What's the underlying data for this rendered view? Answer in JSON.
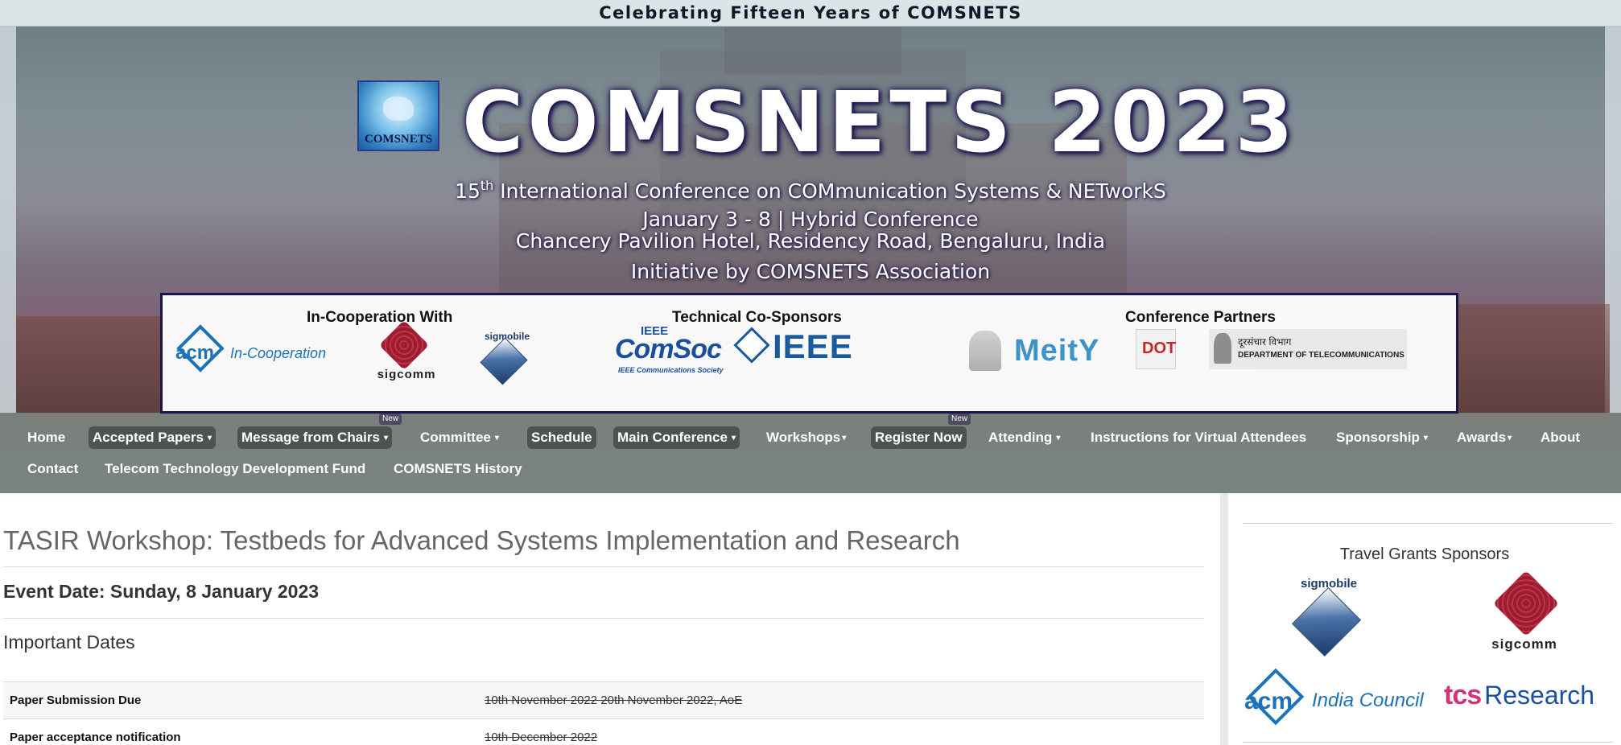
{
  "top_strip": {
    "text": "Celebrating Fifteen Years of COMSNETS"
  },
  "banner": {
    "logo_text": "COMSNETS",
    "title": "COMSNETS 2023",
    "subtitle_num": "15",
    "subtitle_sup": "th",
    "subtitle_rest": " International Conference on COMmunication Systems & NETworkS",
    "dates": "January 3 - 8 | Hybrid Conference",
    "venue": "Chancery Pavilion Hotel, Residency Road, Bengaluru, India",
    "initiative": "Initiative by COMSNETS Association"
  },
  "sponsors": {
    "coop_heading": "In-Cooperation With",
    "tech_heading": "Technical Co-Sponsors",
    "partners_heading": "Conference Partners",
    "acm_mark": "acm",
    "acm_coop": "In-Cooperation",
    "sigcomm": "sigcomm",
    "sigmobile": "sigmobile",
    "comsoc_l1": "IEEE",
    "comsoc_l2": "ComSoc",
    "comsoc_l3": "IEEE Communications Society",
    "ieee": "IEEE",
    "meity": "MeitY",
    "dot": "DOT",
    "dept_hindi": "दूरसंचार विभाग",
    "dept_en": "DEPARTMENT OF TELECOMMUNICATIONS"
  },
  "nav": {
    "home": "Home",
    "accepted_papers": "Accepted Papers",
    "message_from_chairs": "Message from Chairs",
    "committee": "Committee",
    "schedule": "Schedule",
    "main_conference": "Main Conference",
    "workshops": "Workshops",
    "register_now": "Register Now",
    "attending": "Attending",
    "virtual_instructions": "Instructions for Virtual Attendees",
    "sponsorship": "Sponsorship",
    "awards": "Awards",
    "about": "About",
    "contact": "Contact",
    "ttdf": "Telecom Technology Development Fund",
    "history": "COMSNETS History",
    "badge_new": "New",
    "caret": "▾"
  },
  "content": {
    "title": "TASIR Workshop: Testbeds for Advanced Systems Implementation and Research",
    "event_date": "Event Date: Sunday, 8 January 2023",
    "important_dates": "Important Dates",
    "rows": [
      {
        "label": "Paper Submission Due",
        "value": "10th November 2022  20th November 2022, AoE"
      },
      {
        "label": "Paper acceptance notification",
        "value": "10th December 2022"
      }
    ]
  },
  "sidebar": {
    "title": "Travel Grants Sponsors",
    "sigmobile": "sigmobile",
    "sigcomm": "sigcomm",
    "acm_mark": "acm",
    "acm_india": "India Council",
    "tcs": "tcs",
    "research": "Research"
  }
}
